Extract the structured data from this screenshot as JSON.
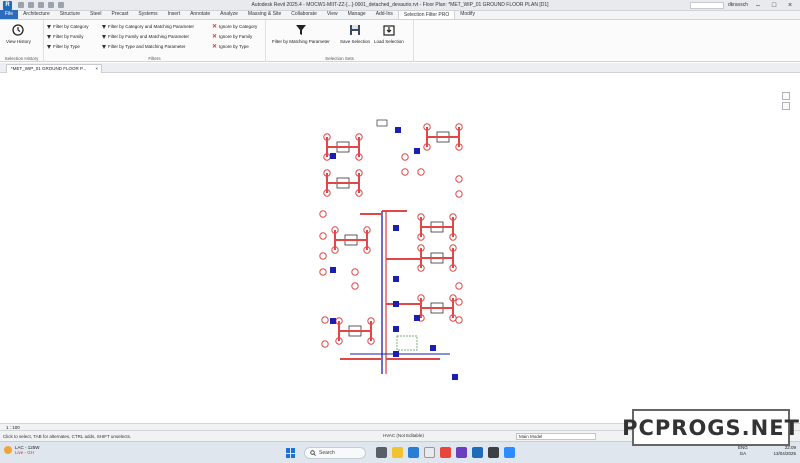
{
  "window": {
    "title": "Autodesk Revit 2025.4 - MOCW1-MIIT-ZZ-[...]-0001_detached_devaurio.rvt - Floor Plan: *MET_WIP_01 GROUND FLOOR PLAN [D1]",
    "user": "dkravsch"
  },
  "ribbon_tabs": [
    "File",
    "Architecture",
    "Structure",
    "Steel",
    "Precast",
    "Systems",
    "Insert",
    "Annotate",
    "Analyze",
    "Massing & Site",
    "Collaborate",
    "View",
    "Manage",
    "Add-Ins",
    "Selection Filter PRO",
    "Modify"
  ],
  "active_tab_index": 14,
  "panels": {
    "selection_history": {
      "label": "Selection History",
      "view_history": "View History"
    },
    "filters": {
      "label": "Filters",
      "col1": [
        "Filter by Category",
        "Filter by Family",
        "Filter by Type"
      ],
      "col2": [
        "Filter by Category and Matching Parameter",
        "Filter by Family and Matching Parameter",
        "Filter by Type and Matching Parameter"
      ],
      "col3": [
        "Ignore by Category",
        "Ignore by Family",
        "Ignore by Type"
      ]
    },
    "selection_sets": {
      "label": "Selection Sets",
      "filter_by_matching": "Filter by Matching Parameter",
      "save_selection": "Save Selection",
      "load_selection": "Load Selection"
    }
  },
  "view_tab": {
    "label": "*MET_WIP_01 GROUND FLOOR P...",
    "close": "×"
  },
  "view_bar": {
    "scale": "1 : 100"
  },
  "status": {
    "hint": "Click to select, TAB for alternates, CTRL adds, SHIFT unselects.",
    "workset": "HVAC (Not Editable)",
    "main_model": "Main Model"
  },
  "taskbar": {
    "weather_temp": "LAC - 125W",
    "weather_live": "Live - GH",
    "search": "Search",
    "lang": "ENG",
    "region": "GA",
    "time": "22:09",
    "date": "13/04/2025"
  },
  "watermark": "PCPROGS.NET",
  "colors": {
    "ribbon_accent": "#2c6cbf",
    "duct_red": "#e04848",
    "equipment_blue": "#1a1fb0",
    "filter_x": "#d23a2c"
  },
  "icons": {
    "view_history": "history-clock-icon",
    "filter": "funnel-icon",
    "save": "save-selection-icon",
    "load": "load-selection-icon"
  }
}
